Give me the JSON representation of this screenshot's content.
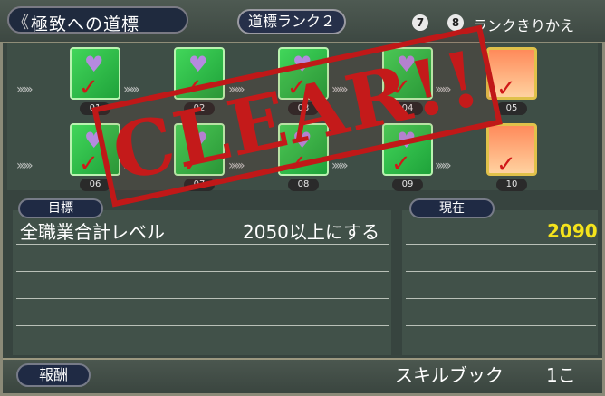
{
  "header": {
    "title": "極致への道標",
    "rank": "道標ランク２",
    "key_a": "7",
    "key_b": "8",
    "switch_label": "ランクきりかえ"
  },
  "milestones": [
    {
      "num": "01",
      "tier": "green"
    },
    {
      "num": "02",
      "tier": "green"
    },
    {
      "num": "03",
      "tier": "green"
    },
    {
      "num": "04",
      "tier": "green"
    },
    {
      "num": "05",
      "tier": "gold"
    },
    {
      "num": "06",
      "tier": "green"
    },
    {
      "num": "07",
      "tier": "green"
    },
    {
      "num": "08",
      "tier": "green"
    },
    {
      "num": "09",
      "tier": "green"
    },
    {
      "num": "10",
      "tier": "gold"
    }
  ],
  "stamp": "CLEAR!!",
  "goal": {
    "label": "目標",
    "description": "全職業合計レベル",
    "condition": "2050以上にする"
  },
  "current": {
    "label": "現在",
    "value": "2090"
  },
  "reward": {
    "label": "報酬",
    "item": "スキルブック",
    "count": "1こ"
  },
  "colors": {
    "accent_yellow": "#f5e31c",
    "stamp_red": "#c41a1a",
    "tile_green": "#2fbf4a",
    "tile_gold_border": "#e0c14a"
  }
}
